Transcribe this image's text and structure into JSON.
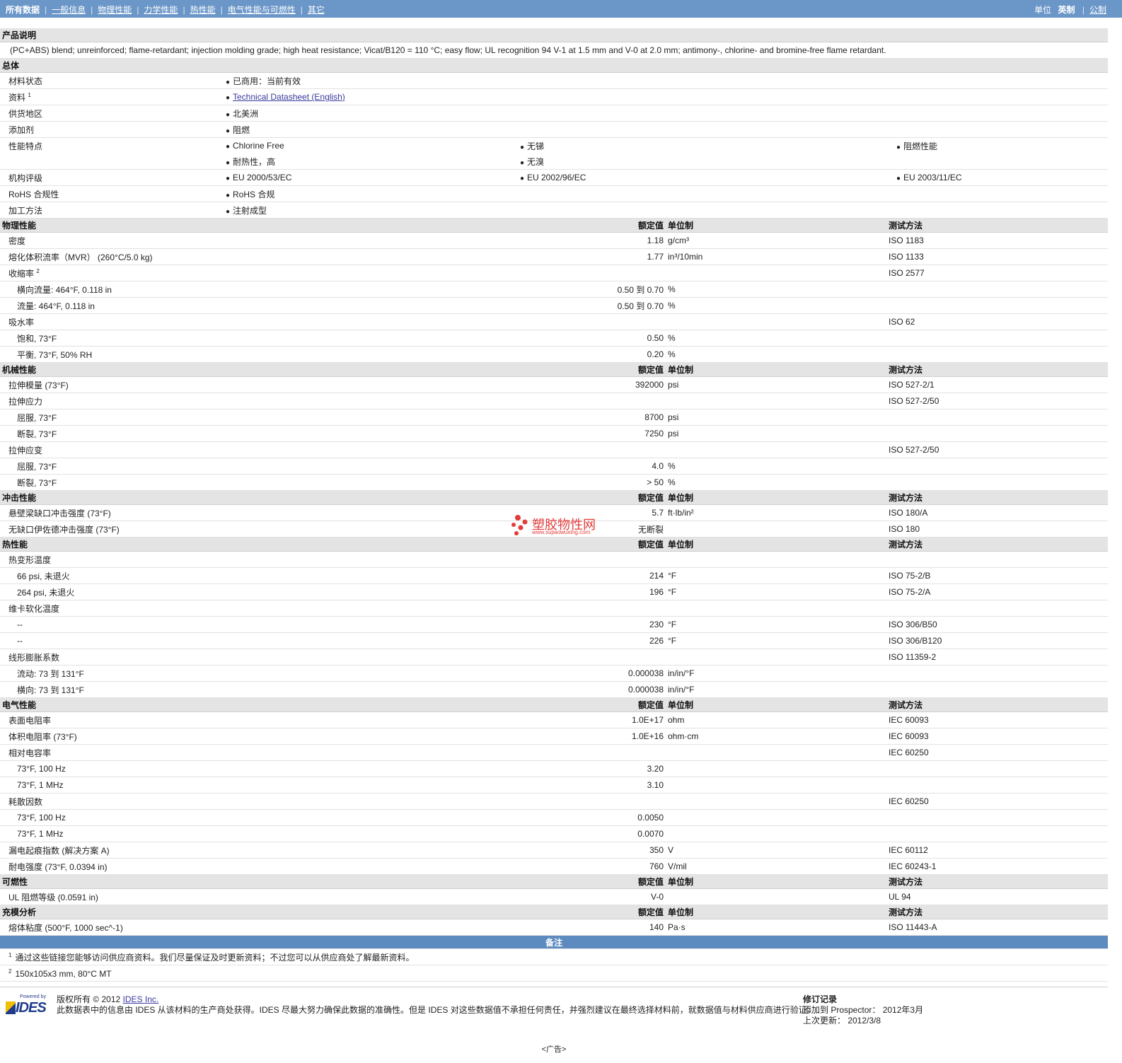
{
  "nav": {
    "items": [
      "所有数据",
      "一般信息",
      "物理性能",
      "力学性能",
      "热性能",
      "电气性能与可燃性",
      "其它"
    ],
    "unit_label": "单位",
    "unit_options": [
      "英制",
      "公制"
    ]
  },
  "header_cols": {
    "nominal": "额定值",
    "unit": "单位制",
    "method": "测试方法"
  },
  "description": {
    "title": "产品说明",
    "text": "(PC+ABS) blend; unreinforced; flame-retardant; injection molding grade; high heat resistance; Vicat/B120 = 110 °C; easy flow; UL recognition 94 V-1 at 1.5 mm and V-0 at 2.0 mm; antimony-, chlorine- and bromine-free flame retardant."
  },
  "general": {
    "title": "总体",
    "rows": [
      {
        "label": "材料状态",
        "items": [
          "已商用：当前有效"
        ]
      },
      {
        "label": "资料",
        "sup": "1",
        "items": [
          "Technical Datasheet (English)"
        ],
        "link": true
      },
      {
        "label": "供货地区",
        "items": [
          "北美洲"
        ]
      },
      {
        "label": "添加剂",
        "items": [
          "阻燃"
        ]
      },
      {
        "label": "性能特点",
        "items": [
          "Chlorine Free",
          "无锑",
          "阻燃性能",
          "耐热性，高",
          "无溴"
        ]
      },
      {
        "label": "机构评级",
        "items": [
          "EU 2000/53/EC",
          "EU 2002/96/EC",
          "EU 2003/11/EC"
        ]
      },
      {
        "label": "RoHS 合规性",
        "items": [
          "RoHS 合规"
        ]
      },
      {
        "label": "加工方法",
        "items": [
          "注射成型"
        ]
      }
    ]
  },
  "sections": [
    {
      "title": "物理性能",
      "rows": [
        {
          "name": "密度",
          "val": "1.18",
          "unit": "g/cm³",
          "method": "ISO 1183"
        },
        {
          "name": "熔化体积流率（MVR） (260°C/5.0 kg)",
          "val": "1.77",
          "unit": "in³/10min",
          "method": "ISO 1133"
        },
        {
          "name": "收缩率",
          "sup": "2",
          "method": "ISO 2577"
        },
        {
          "name": "横向流量: 464°F, 0.118 in",
          "sub": true,
          "val": "0.50 到  0.70",
          "unit": "%"
        },
        {
          "name": "流量: 464°F, 0.118 in",
          "sub": true,
          "val": "0.50 到  0.70",
          "unit": "%"
        },
        {
          "name": "吸水率",
          "method": "ISO 62"
        },
        {
          "name": "饱和, 73°F",
          "sub": true,
          "val": "0.50",
          "unit": "%"
        },
        {
          "name": "平衡, 73°F, 50% RH",
          "sub": true,
          "val": "0.20",
          "unit": "%"
        }
      ]
    },
    {
      "title": "机械性能",
      "rows": [
        {
          "name": "拉伸模量 (73°F)",
          "val": "392000",
          "unit": "psi",
          "method": "ISO 527-2/1"
        },
        {
          "name": "拉伸应力",
          "method": "ISO 527-2/50"
        },
        {
          "name": "屈服, 73°F",
          "sub": true,
          "val": "8700",
          "unit": "psi"
        },
        {
          "name": "断裂, 73°F",
          "sub": true,
          "val": "7250",
          "unit": "psi"
        },
        {
          "name": "拉伸应变",
          "method": "ISO 527-2/50"
        },
        {
          "name": "屈服, 73°F",
          "sub": true,
          "val": "4.0",
          "unit": "%"
        },
        {
          "name": "断裂, 73°F",
          "sub": true,
          "val": "> 50",
          "unit": "%"
        }
      ]
    },
    {
      "title": "冲击性能",
      "rows": [
        {
          "name": "悬壁梁缺口冲击强度 (73°F)",
          "val": "5.7",
          "unit": "ft·lb/in²",
          "method": "ISO 180/A"
        },
        {
          "name": "无缺口伊佐德冲击强度 (73°F)",
          "val": "无断裂",
          "unit": "",
          "method": "ISO 180"
        }
      ]
    },
    {
      "title": "热性能",
      "rows": [
        {
          "name": "热变形温度"
        },
        {
          "name": "66 psi, 未退火",
          "sub": true,
          "val": "214",
          "unit": "°F",
          "method": "ISO 75-2/B"
        },
        {
          "name": "264 psi, 未退火",
          "sub": true,
          "val": "196",
          "unit": "°F",
          "method": "ISO 75-2/A"
        },
        {
          "name": "维卡软化温度"
        },
        {
          "name": "--",
          "sub": true,
          "val": "230",
          "unit": "°F",
          "method": "ISO 306/B50"
        },
        {
          "name": "--",
          "sub": true,
          "val": "226",
          "unit": "°F",
          "method": "ISO 306/B120"
        },
        {
          "name": "线形膨胀系数",
          "method": "ISO 11359-2"
        },
        {
          "name": "流动: 73 到  131°F",
          "sub": true,
          "val": "0.000038",
          "unit": "in/in/°F"
        },
        {
          "name": "横向: 73 到  131°F",
          "sub": true,
          "val": "0.000038",
          "unit": "in/in/°F"
        }
      ]
    },
    {
      "title": "电气性能",
      "rows": [
        {
          "name": "表面电阻率",
          "val": "1.0E+17",
          "unit": "ohm",
          "method": "IEC 60093"
        },
        {
          "name": "体积电阻率 (73°F)",
          "val": "1.0E+16",
          "unit": "ohm·cm",
          "method": "IEC 60093"
        },
        {
          "name": "相对电容率",
          "method": "IEC 60250"
        },
        {
          "name": "73°F, 100 Hz",
          "sub": true,
          "val": "3.20"
        },
        {
          "name": "73°F, 1 MHz",
          "sub": true,
          "val": "3.10"
        },
        {
          "name": "耗散因数",
          "method": "IEC 60250"
        },
        {
          "name": "73°F, 100 Hz",
          "sub": true,
          "val": "0.0050"
        },
        {
          "name": "73°F, 1 MHz",
          "sub": true,
          "val": "0.0070"
        },
        {
          "name": "漏电起痕指数 (解决方案 A)",
          "val": "350",
          "unit": "V",
          "method": "IEC 60112"
        },
        {
          "name": "耐电强度 (73°F, 0.0394 in)",
          "val": "760",
          "unit": "V/mil",
          "method": "IEC 60243-1"
        }
      ]
    },
    {
      "title": "可燃性",
      "rows": [
        {
          "name": "UL 阻燃等级 (0.0591 in)",
          "val": "V-0",
          "unit": "",
          "method": "UL 94"
        }
      ]
    },
    {
      "title": "充模分析",
      "rows": [
        {
          "name": "熔体粘度 (500°F, 1000 sec^-1)",
          "val": "140",
          "unit": "Pa·s",
          "method": "ISO 11443-A"
        }
      ]
    }
  ],
  "notes": {
    "title": "备注",
    "items": [
      {
        "sup": "1",
        "text": "通过这些链接您能够访问供应商资料。我们尽量保证及时更新资料；不过您可以从供应商处了解最新资料。"
      },
      {
        "sup": "2",
        "text": "150x105x3 mm, 80°C MT"
      }
    ]
  },
  "footer": {
    "logo_powered": "Powered by",
    "logo_name": "IDES",
    "copyright_prefix": "版权所有 © 2012 ",
    "copyright_link": "IDES Inc.",
    "disclaimer": "此数据表中的信息由 IDES 从该材料的生产商处获得。IDES 尽最大努力确保此数据的准确性。但是 IDES 对这些数据值不承担任何责任，并强烈建议在最终选择材料前，就数据值与材料供应商进行验证。",
    "rev_title": "修订记录",
    "rev_added": "添加到 Prospector： 2012年3月",
    "rev_updated": "上次更新： 2012/3/8",
    "ad": "<广告>"
  },
  "watermark": {
    "text": "塑胶物性网",
    "url": "www.sujiaowuxing.com"
  },
  "colors": {
    "nav_bg": "#6a96c8",
    "section_bg": "#e4e4e4",
    "notes_bg": "#5d8bbf"
  }
}
